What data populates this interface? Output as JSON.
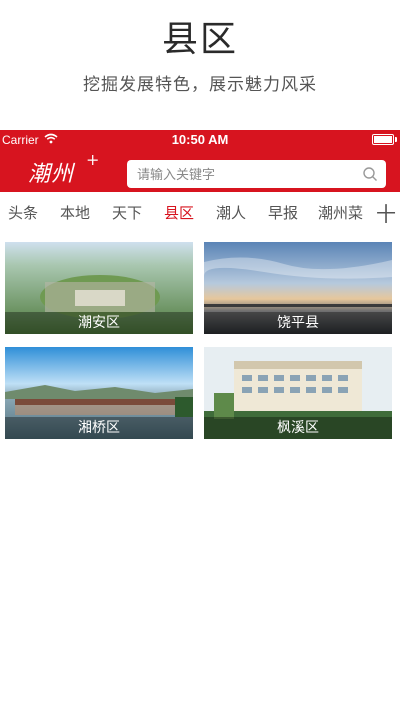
{
  "promo": {
    "title": "县区",
    "subtitle": "挖掘发展特色，展示魅力风采"
  },
  "status_bar": {
    "carrier": "Carrier",
    "time": "10:50 AM"
  },
  "app_bar": {
    "logo_text": "潮州",
    "logo_plus": "+",
    "search_placeholder": "请输入关键字"
  },
  "tabs": [
    {
      "label": "头条"
    },
    {
      "label": "本地"
    },
    {
      "label": "天下"
    },
    {
      "label": "县区"
    },
    {
      "label": "潮人"
    },
    {
      "label": "早报"
    },
    {
      "label": "潮州菜"
    }
  ],
  "active_tab": "县区",
  "add_tab_label": "十",
  "districts": [
    {
      "name": "潮安区"
    },
    {
      "name": "饶平县"
    },
    {
      "name": "湘桥区"
    },
    {
      "name": "枫溪区"
    }
  ],
  "colors": {
    "brand_red": "#d7141f"
  }
}
